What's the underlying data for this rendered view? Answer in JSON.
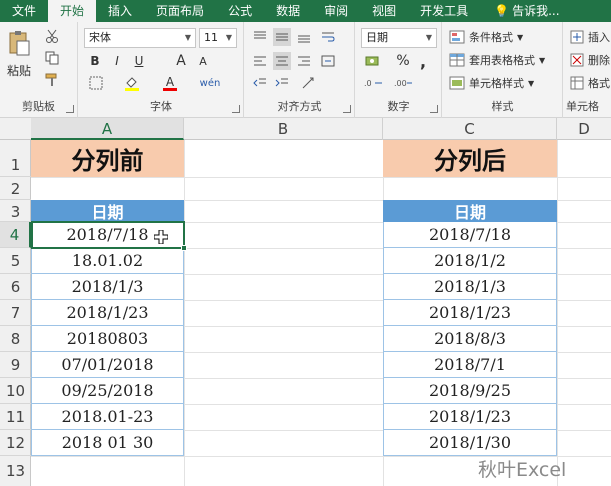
{
  "ribbon": {
    "tabs": [
      {
        "label": "文件"
      },
      {
        "label": "开始"
      },
      {
        "label": "插入"
      },
      {
        "label": "页面布局"
      },
      {
        "label": "公式"
      },
      {
        "label": "数据"
      },
      {
        "label": "审阅"
      },
      {
        "label": "视图"
      },
      {
        "label": "开发工具"
      }
    ],
    "tell_me": "告诉我...",
    "clipboard": {
      "paste_label": "粘贴",
      "group_label": "剪贴板"
    },
    "font": {
      "name": "宋体",
      "size": "11",
      "group_label": "字体",
      "bold": "B",
      "italic": "I",
      "underline": "U",
      "grow": "A",
      "shrink": "A",
      "wen": "wén"
    },
    "alignment": {
      "group_label": "对齐方式"
    },
    "number": {
      "format": "日期",
      "group_label": "数字",
      "percent": "%",
      "comma": ","
    },
    "styles": {
      "conditional": "条件格式",
      "table": "套用表格格式",
      "cell": "单元格样式",
      "group_label": "样式"
    },
    "cells": {
      "insert": "插入",
      "delete": "删除",
      "format": "格式",
      "group_label": "单元格"
    }
  },
  "sheet": {
    "columns": [
      "A",
      "B",
      "C",
      "D"
    ],
    "rows": [
      "1",
      "2",
      "3",
      "4",
      "5",
      "6",
      "7",
      "8",
      "9",
      "10",
      "11",
      "12",
      "13"
    ],
    "before_title": "分列前",
    "after_title": "分列后",
    "header_label": "日期",
    "before_values": [
      "2018/7/18",
      "18.01.02",
      "2018/1/3",
      "2018/1/23",
      "20180803",
      "07/01/2018",
      "09/25/2018",
      "2018.01-23",
      "2018 01 30"
    ],
    "after_values": [
      "2018/7/18",
      "2018/1/2",
      "2018/1/3",
      "2018/1/23",
      "2018/8/3",
      "2018/7/1",
      "2018/9/25",
      "2018/1/23",
      "2018/1/30"
    ]
  },
  "watermark": "秋叶Excel",
  "colors": {
    "accent": "#217346",
    "title_fill": "#f8cbad",
    "header_fill": "#5b9bd5"
  }
}
